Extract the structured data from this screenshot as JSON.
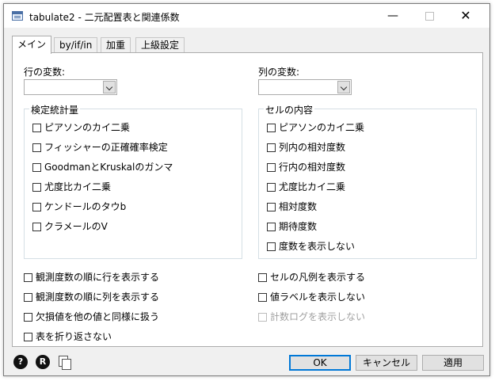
{
  "window": {
    "title": "tabulate2 - 二元配置表と関連係数",
    "icon": "dialog-icon",
    "minimize": "—",
    "close": "✕"
  },
  "tabs": [
    {
      "label": "メイン",
      "active": true
    },
    {
      "label": "by/if/in",
      "active": false
    },
    {
      "label": "加重",
      "active": false
    },
    {
      "label": "上級設定",
      "active": false
    }
  ],
  "main": {
    "row_var": {
      "label": "行の変数:",
      "value": ""
    },
    "col_var": {
      "label": "列の変数:",
      "value": ""
    },
    "stats_group": {
      "title": "検定統計量",
      "items": [
        {
          "label": "ピアソンのカイ二乗",
          "checked": false
        },
        {
          "label": "フィッシャーの正確確率検定",
          "checked": false
        },
        {
          "label": "GoodmanとKruskalのガンマ",
          "checked": false
        },
        {
          "label": "尤度比カイ二乗",
          "checked": false
        },
        {
          "label": "ケンドールのタウb",
          "checked": false
        },
        {
          "label": "クラメールのV",
          "checked": false
        }
      ]
    },
    "cell_group": {
      "title": "セルの内容",
      "items": [
        {
          "label": "ピアソンのカイ二乗",
          "checked": false
        },
        {
          "label": "列内の相対度数",
          "checked": false
        },
        {
          "label": "行内の相対度数",
          "checked": false
        },
        {
          "label": "尤度比カイ二乗",
          "checked": false
        },
        {
          "label": "相対度数",
          "checked": false
        },
        {
          "label": "期待度数",
          "checked": false
        },
        {
          "label": "度数を表示しない",
          "checked": false
        }
      ]
    },
    "left_options": [
      {
        "label": "観測度数の順に行を表示する",
        "checked": false
      },
      {
        "label": "観測度数の順に列を表示する",
        "checked": false
      },
      {
        "label": "欠損値を他の値と同様に扱う",
        "checked": false
      },
      {
        "label": "表を折り返さない",
        "checked": false
      }
    ],
    "right_options": [
      {
        "label": "セルの凡例を表示する",
        "checked": false,
        "enabled": true
      },
      {
        "label": "値ラベルを表示しない",
        "checked": false,
        "enabled": true
      },
      {
        "label": "計数ログを表示しない",
        "checked": false,
        "enabled": false
      }
    ]
  },
  "footer": {
    "help_icon": "?",
    "reset_icon": "R",
    "copy_icon": "copy-icon",
    "ok_label": "OK",
    "cancel_label": "キャンセル",
    "apply_label": "適用"
  },
  "colors": {
    "accent": "#0078d7",
    "dialog_bg": "#f0f0f0",
    "panel_bg": "#ffffff"
  }
}
